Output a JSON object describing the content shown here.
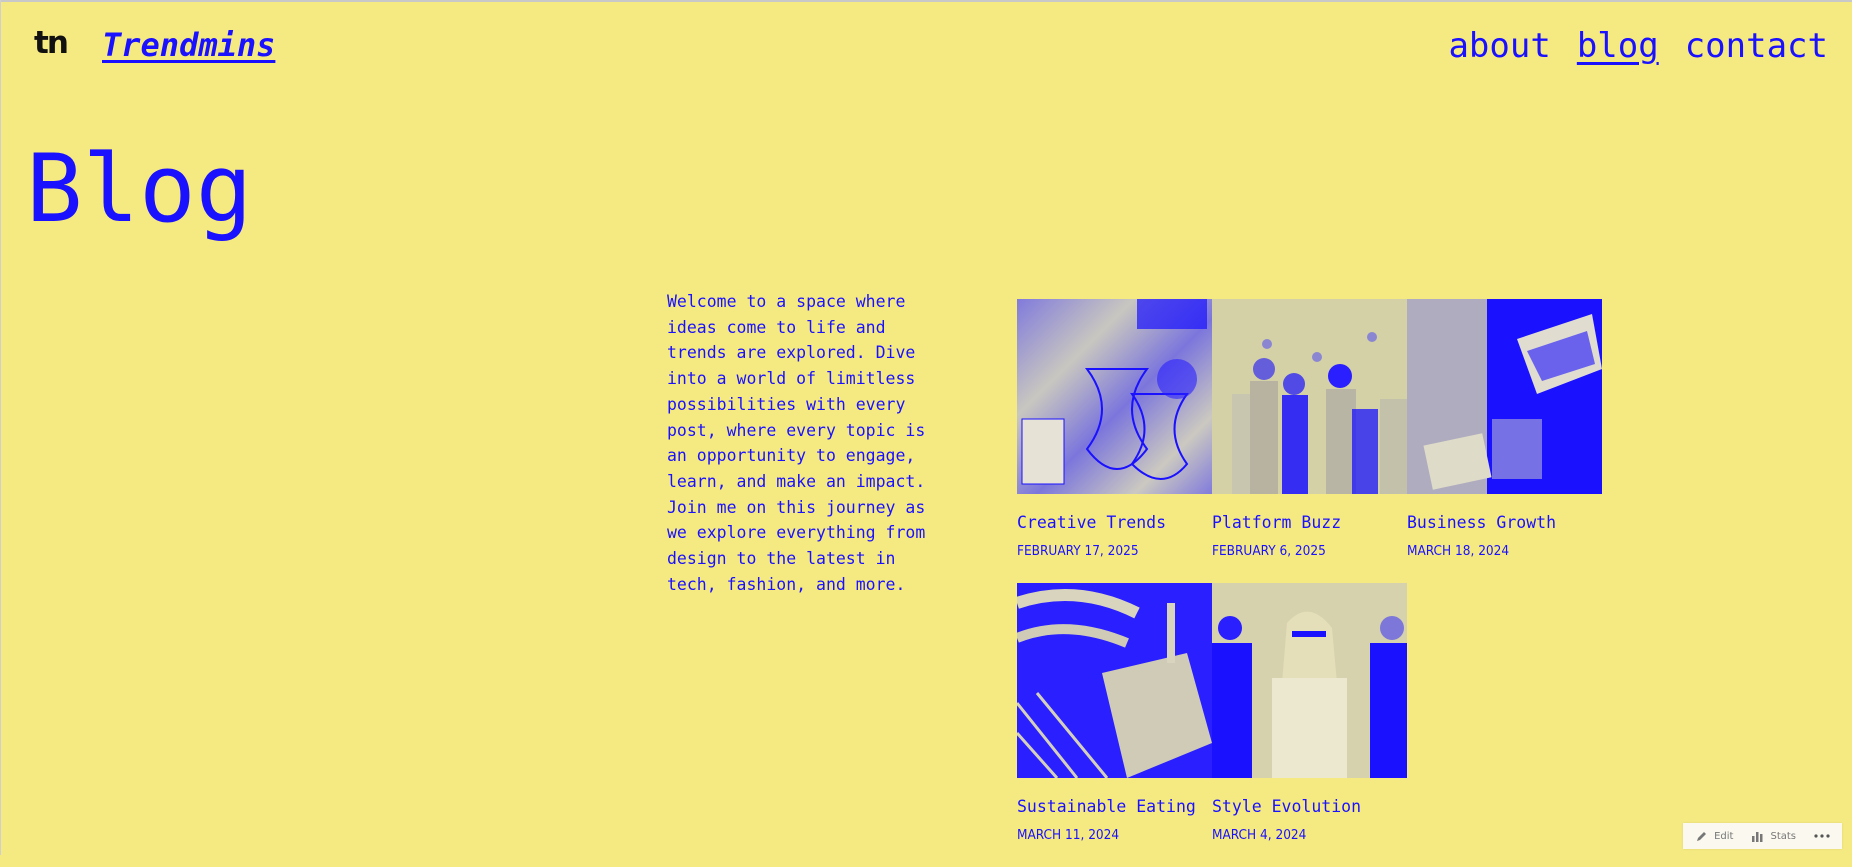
{
  "header": {
    "logo_mark": "tn",
    "site_title": "Trendmins",
    "nav": [
      {
        "label": "about",
        "current": false
      },
      {
        "label": "blog",
        "current": true
      },
      {
        "label": "contact",
        "current": false
      }
    ]
  },
  "page": {
    "title": "Blog",
    "intro": "Welcome to a space where ideas come to life and trends are explored. Dive into a world of limitless possibilities with every post, where every topic is an opportunity to engage, learn, and make an impact. Join me on this journey as we explore everything from design to the latest in tech, fashion, and more."
  },
  "posts": [
    {
      "title": "Creative Trends",
      "date": "FEBRUARY 17, 2025"
    },
    {
      "title": "Platform Buzz",
      "date": "FEBRUARY 6, 2025"
    },
    {
      "title": "Business Growth",
      "date": "MARCH 18, 2024"
    },
    {
      "title": "Sustainable Eating",
      "date": "MARCH 11, 2024"
    },
    {
      "title": "Style Evolution",
      "date": "MARCH 4, 2024"
    }
  ],
  "adminbar": {
    "edit_label": "Edit",
    "stats_label": "Stats"
  },
  "colors": {
    "background": "#f5ea82",
    "accent": "#1a11ff"
  }
}
